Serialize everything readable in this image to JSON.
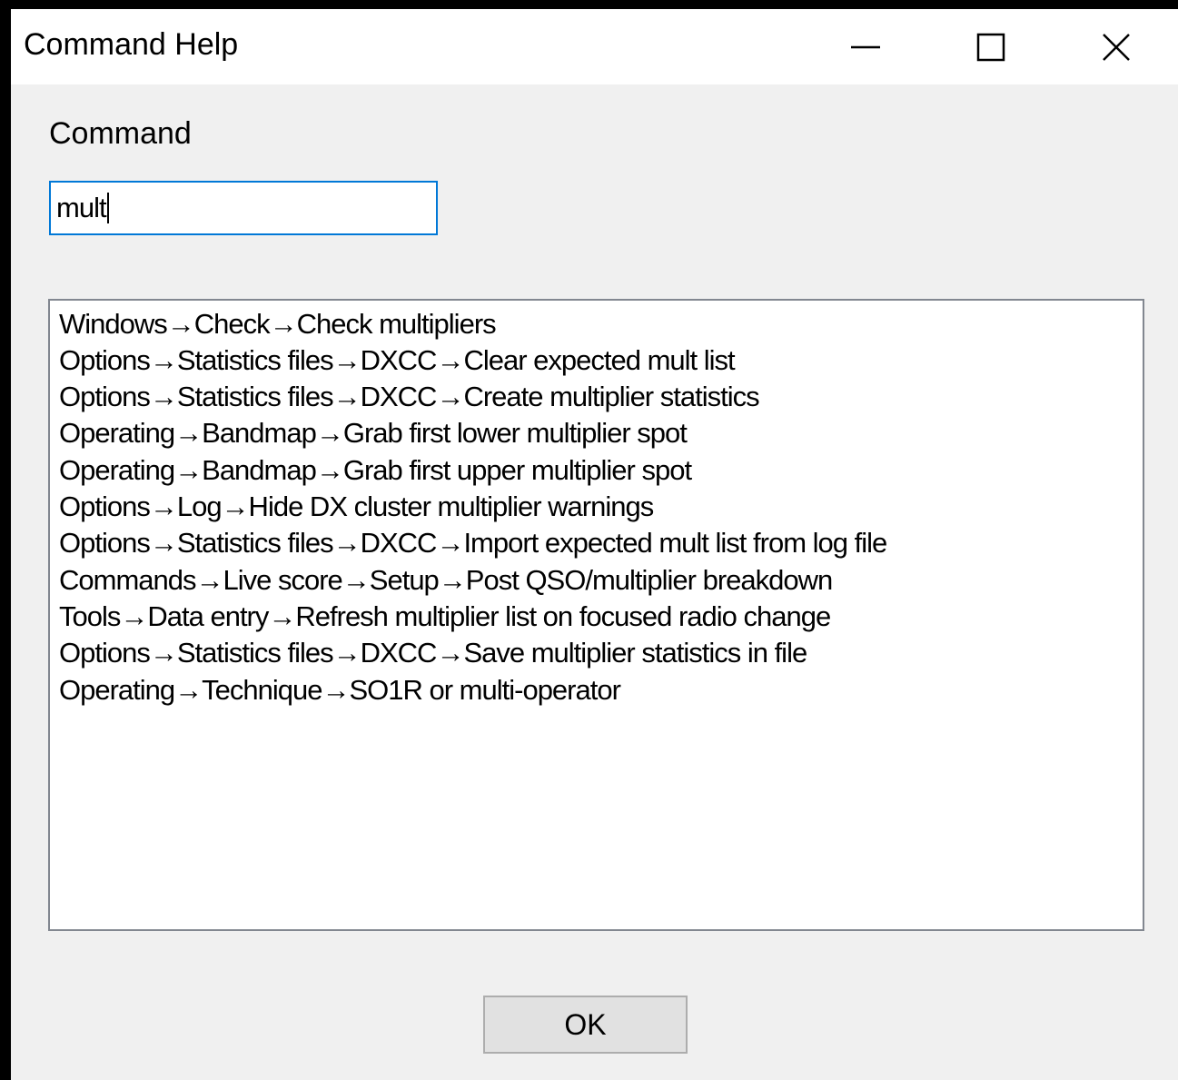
{
  "window": {
    "title": "Command Help",
    "controls": {
      "minimize": "minimize-icon",
      "maximize": "maximize-icon",
      "close": "close-icon"
    }
  },
  "form": {
    "command_label": "Command",
    "command_value": "mult"
  },
  "results": [
    "Windows→Check→Check multipliers",
    "Options→Statistics files→DXCC→Clear expected mult list",
    "Options→Statistics files→DXCC→Create multiplier statistics",
    "Operating→Bandmap→Grab first lower multiplier spot",
    "Operating→Bandmap→Grab first upper multiplier spot",
    "Options→Log→Hide DX cluster multiplier warnings",
    "Options→Statistics files→DXCC→Import expected mult list from log file",
    "Commands→Live score→Setup→Post QSO/multiplier breakdown",
    "Tools→Data entry→Refresh multiplier list on focused radio change",
    "Options→Statistics files→DXCC→Save multiplier statistics in file",
    "Operating→Technique→SO1R or multi-operator"
  ],
  "buttons": {
    "ok_label": "OK"
  },
  "colors": {
    "input_focus_border": "#0078d7",
    "dialog_background": "#f0f0f0",
    "titlebar_background": "#ffffff",
    "listbox_border": "#828790",
    "button_face": "#e1e1e1"
  }
}
